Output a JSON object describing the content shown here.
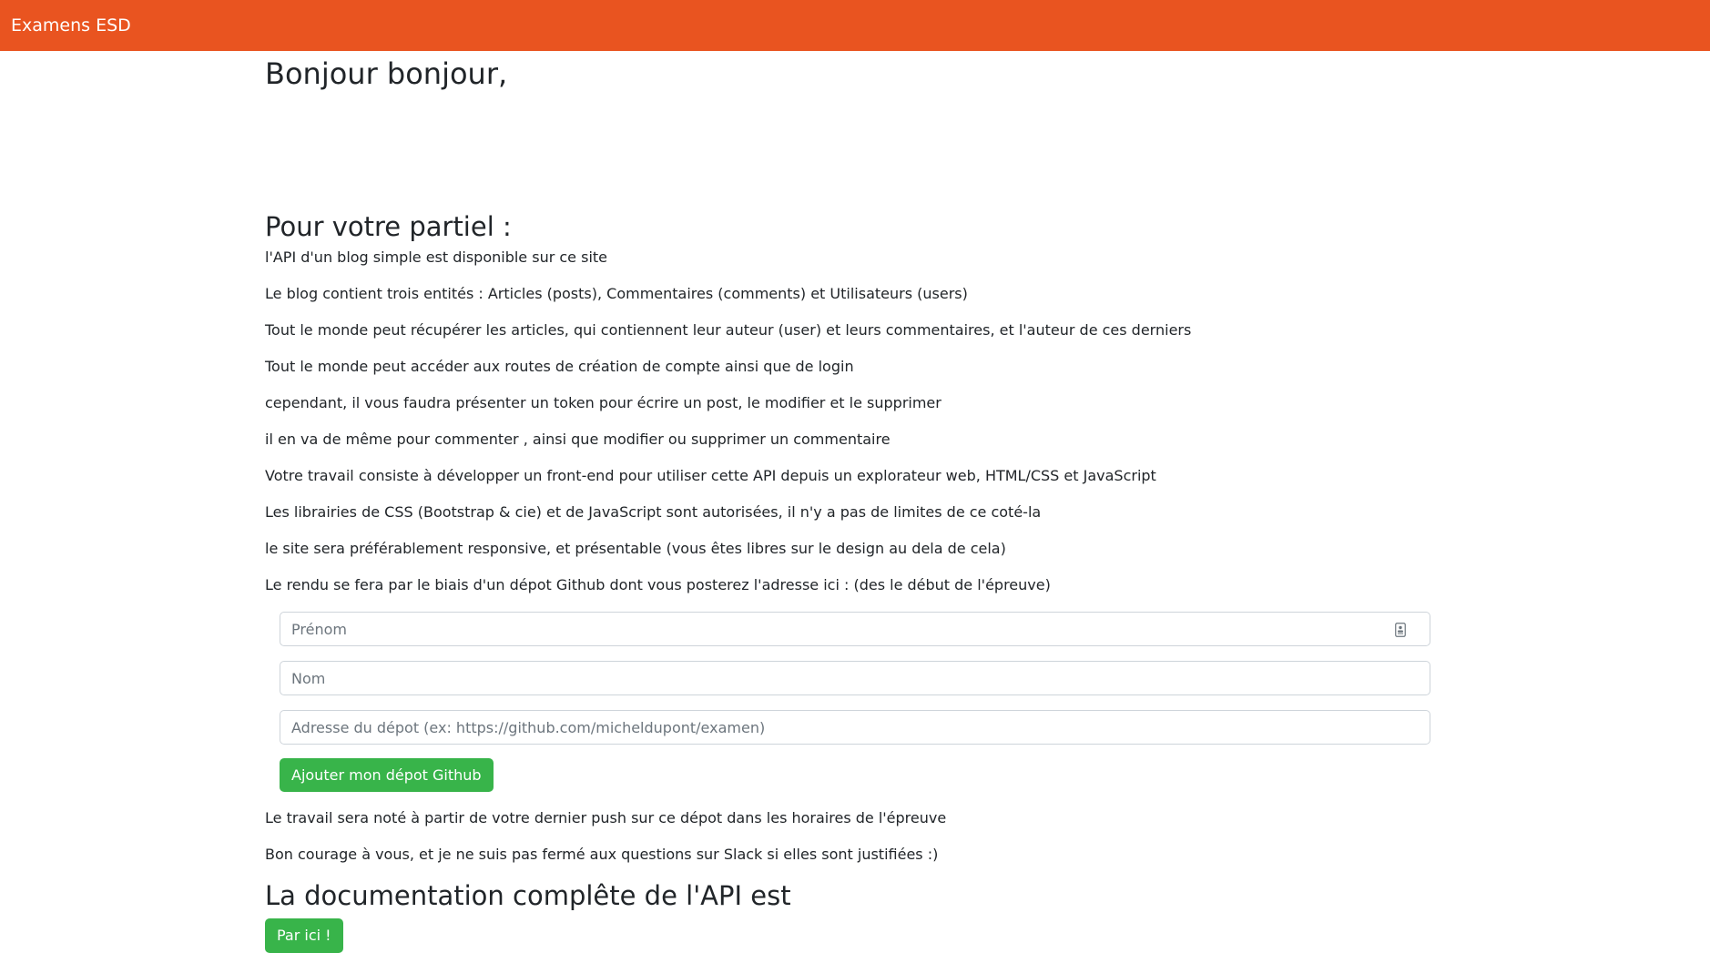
{
  "navbar": {
    "brand": "Examens ESD"
  },
  "main": {
    "greeting": "Bonjour bonjour,",
    "section_title": "Pour votre partiel :",
    "paragraphs": [
      "l'API d'un blog simple est disponible sur ce site",
      "Le blog contient trois entités : Articles (posts), Commentaires (comments) et Utilisateurs (users)",
      "Tout le monde peut récupérer les articles, qui contiennent leur auteur (user) et leurs commentaires, et l'auteur de ces derniers",
      "Tout le monde peut accéder aux routes de création de compte ainsi que de login",
      "cependant, il vous faudra présenter un token pour écrire un post, le modifier et le supprimer",
      "il en va de même pour commenter , ainsi que modifier ou supprimer un commentaire",
      "Votre travail consiste à développer un front-end pour utiliser cette API depuis un explorateur web, HTML/CSS et JavaScript",
      "Les librairies de CSS (Bootstrap & cie) et de JavaScript sont autorisées, il n'y a pas de limites de ce coté-la",
      "le site sera préférablement responsive, et présentable (vous êtes libres sur le design au dela de cela)",
      "Le rendu se fera par le biais d'un dépot Github dont vous posterez l'adresse ici : (des le début de l'épreuve)"
    ],
    "after_form": [
      "Le travail sera noté à partir de votre dernier push sur ce dépot dans les horaires de l'épreuve",
      "Bon courage à vous, et je ne suis pas fermé aux questions sur Slack si elles sont justifiées :)"
    ],
    "doc_title": "La documentation complête de l'API est",
    "doc_button": "Par ici !"
  },
  "form": {
    "firstname_placeholder": "Prénom",
    "lastname_placeholder": "Nom",
    "repo_placeholder": "Adresse du dépot (ex: https://github.com/micheldupont/examen)",
    "submit_label": "Ajouter mon dépot Github",
    "firstname_icon": "contact-card-icon"
  },
  "colors": {
    "navbar": "#e95420",
    "button_success": "#38b44a",
    "text": "#212529"
  }
}
